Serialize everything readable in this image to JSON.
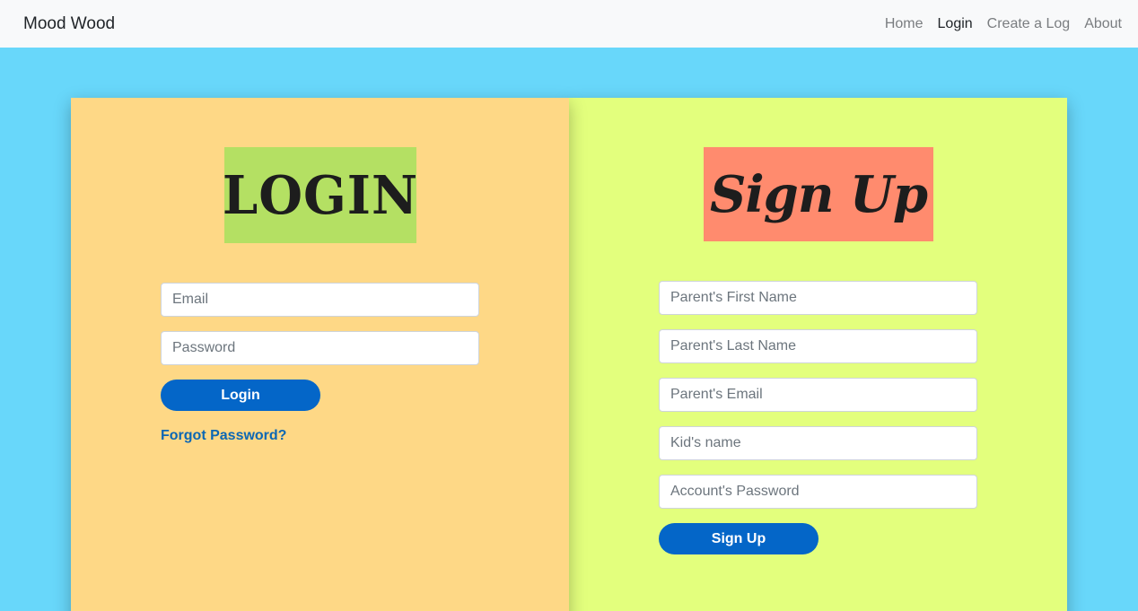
{
  "nav": {
    "brand": "Mood Wood",
    "links": [
      "Home",
      "Login",
      "Create a Log",
      "About"
    ],
    "active": "Login"
  },
  "login": {
    "logo_text": "LOGIN",
    "email_placeholder": "Email",
    "password_placeholder": "Password",
    "button_label": "Login",
    "forgot_label": "Forgot Password?"
  },
  "signup": {
    "logo_text": "Sign Up",
    "fields": [
      "Parent's First Name",
      "Parent's Last Name",
      "Parent's Email",
      "Kid's name",
      "Account's Password"
    ],
    "button_label": "Sign Up"
  },
  "colors": {
    "page_bg": "#68d7fa",
    "login_panel": "#fed886",
    "signup_panel": "#e3ff7d",
    "login_logo_bg": "#b4e063",
    "signup_logo_bg": "#ff8b6e",
    "button": "#0466c8"
  }
}
